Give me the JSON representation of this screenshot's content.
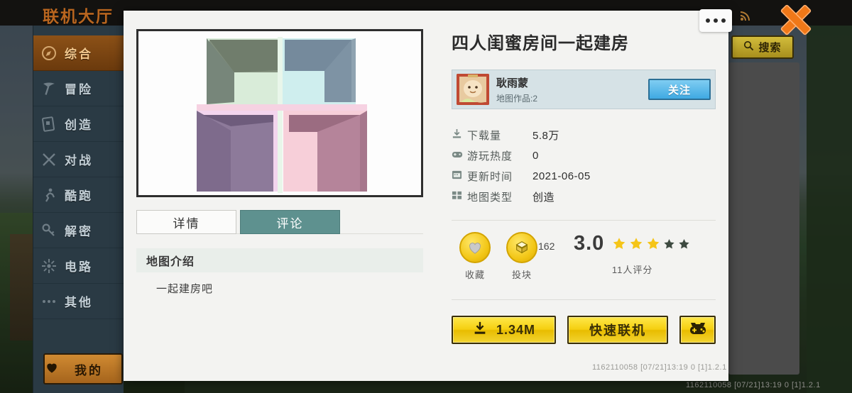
{
  "background": {
    "header_title": "联机大厅",
    "search_button": {
      "label": "搜索",
      "icon": "search-icon"
    },
    "close_button": {
      "icon": "close-x-icon",
      "color": "#f07818"
    },
    "wifi_icon": "wifi-icon",
    "sidebar": {
      "items": [
        {
          "label": "综合",
          "icon": "compass-icon",
          "active": true
        },
        {
          "label": "冒险",
          "icon": "pickaxe-icon",
          "active": false
        },
        {
          "label": "创造",
          "icon": "blueprint-icon",
          "active": false
        },
        {
          "label": "对战",
          "icon": "crossed-swords-icon",
          "active": false
        },
        {
          "label": "酷跑",
          "icon": "runner-icon",
          "active": false
        },
        {
          "label": "解密",
          "icon": "key-icon",
          "active": false
        },
        {
          "label": "电路",
          "icon": "circuit-icon",
          "active": false
        },
        {
          "label": "其他",
          "icon": "dots-icon",
          "active": false
        }
      ],
      "mine": {
        "label": "我的",
        "icon": "heart-icon"
      }
    }
  },
  "dialog": {
    "kebab_menu": {
      "icon": "kebab-menu-icon"
    },
    "thumbnail": {
      "alt": "map-preview-four-rooms",
      "quadrant_colors": [
        "#8f9a8c",
        "#7e93a4",
        "#8d7a9a",
        "#b5849a"
      ]
    },
    "tabs": [
      {
        "label": "详情",
        "active": false
      },
      {
        "label": "评论",
        "active": true
      }
    ],
    "description": {
      "heading": "地图介绍",
      "body": "一起建房吧"
    },
    "map_title": "四人闺蜜房间一起建房",
    "author": {
      "avatar_icon": "user-avatar",
      "name": "耿雨蒙",
      "works_label": "地图作品:2",
      "follow_button": "关注"
    },
    "stats": [
      {
        "icon": "download-icon",
        "key": "下载量",
        "value": "5.8万"
      },
      {
        "icon": "gamepad-icon",
        "key": "游玩热度",
        "value": "0"
      },
      {
        "icon": "calendar-icon",
        "key": "更新时间",
        "value": "2021-06-05"
      },
      {
        "icon": "grid-icon",
        "key": "地图类型",
        "value": "创造"
      }
    ],
    "engagement": {
      "favorite": {
        "icon": "heart-coin-icon",
        "label": "收藏"
      },
      "vote": {
        "icon": "block-coin-icon",
        "label": "投块",
        "count": "162"
      },
      "rating": {
        "score": "3.0",
        "stars_filled": 3,
        "stars_total": 5,
        "filled_color": "#f5c518",
        "empty_color": "#3d4a40",
        "sub_label": "11人评分"
      }
    },
    "actions": {
      "download": {
        "icon": "download-icon",
        "label": "1.34M"
      },
      "quick_join": {
        "label": "快速联机"
      },
      "gamepad": {
        "icon": "gamepad-icon"
      }
    },
    "status_text": "1162110058   [07/21]13:19 0  [1]1.2.1"
  },
  "background_status_text": "1162110058   [07/21]13:19 0  [1]1.2.1"
}
